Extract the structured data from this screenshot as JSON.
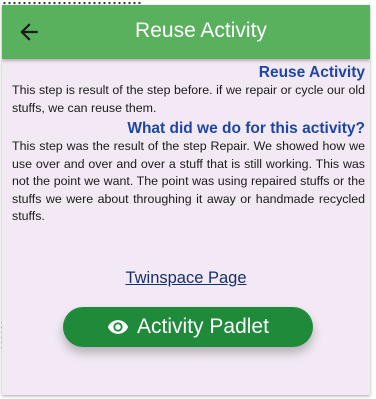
{
  "appbar": {
    "title": "Reuse Activity",
    "back_icon": "arrow-left-icon"
  },
  "section1": {
    "heading": "Reuse Activity",
    "text": "This step is result of the step before. if we repair or cycle our old stuffs, we can reuse them."
  },
  "section2": {
    "heading": "What did we do for this activity?",
    "text": "This step was the result of the step Repair. We showed how we use over and over and over a stuff that is still working. This was not the point we want. The point was using repaired stuffs or the stuffs we were about throughing it away or handmade recycled stuffs."
  },
  "links": {
    "twinspace": "Twinspace Page"
  },
  "buttons": {
    "padlet_label": "Activity Padlet",
    "padlet_icon": "eye-icon"
  },
  "colors": {
    "appbar": "#59b05d",
    "heading": "#1e47a3",
    "button": "#1e8a3a",
    "background": "#f2e9f4",
    "link": "#17306a"
  }
}
